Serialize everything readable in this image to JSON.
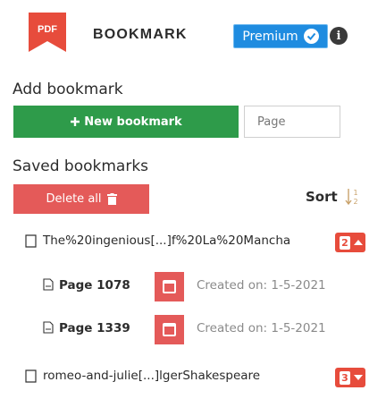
{
  "header": {
    "logo_text": "PDF",
    "brand": "BOOKMARK",
    "premium_label": "Premium",
    "info_label": "i"
  },
  "add_section": {
    "title": "Add bookmark",
    "new_button_label": "New bookmark",
    "page_placeholder": "Page"
  },
  "saved_section": {
    "title": "Saved bookmarks",
    "delete_all_label": "Delete all",
    "sort_label": "Sort"
  },
  "files": [
    {
      "name": "The%20ingenious[...]f%20La%20Mancha",
      "count": "2",
      "bookmarks": [
        {
          "label": "Page 1078",
          "created": "Created on: 1-5-2021"
        },
        {
          "label": "Page 1339",
          "created": "Created on: 1-5-2021"
        }
      ]
    },
    {
      "name": "romeo-and-julie[...]lgerShakespeare",
      "count": "3",
      "bookmarks": []
    }
  ],
  "colors": {
    "green": "#2e9b4a",
    "red": "#e45a59",
    "blue": "#1f8ce0"
  }
}
